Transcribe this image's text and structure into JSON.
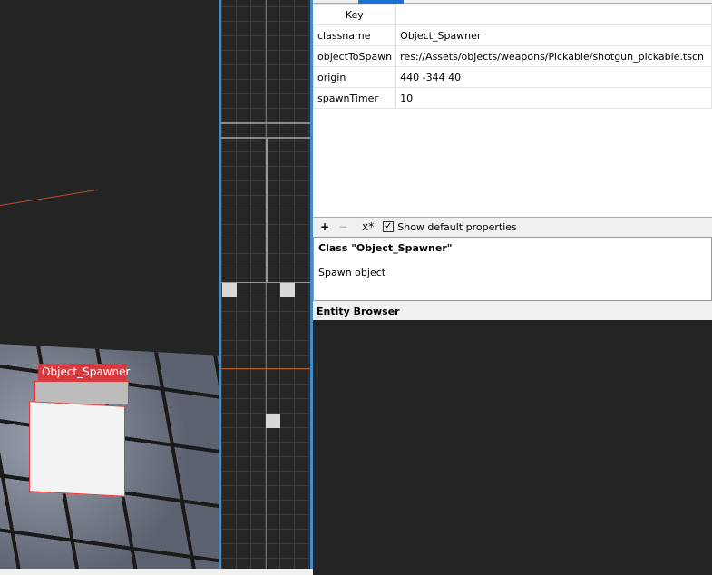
{
  "viewport": {
    "entity_label": "Object_Spawner"
  },
  "properties": {
    "header": "Key",
    "rows": [
      {
        "key": "classname",
        "value": "Object_Spawner"
      },
      {
        "key": "objectToSpawn",
        "value": "res://Assets/objects/weapons/Pickable/shotgun_pickable.tscn"
      },
      {
        "key": "origin",
        "value": "440 -344 40"
      },
      {
        "key": "spawnTimer",
        "value": "10"
      }
    ]
  },
  "toolbar": {
    "add": "+",
    "remove": "−",
    "clear": "x*",
    "show_default": "Show default properties",
    "checked": true
  },
  "class_info": {
    "title": "Class \"Object_Spawner\"",
    "description": "Spawn object"
  },
  "entity_browser": {
    "title": "Entity Browser"
  }
}
